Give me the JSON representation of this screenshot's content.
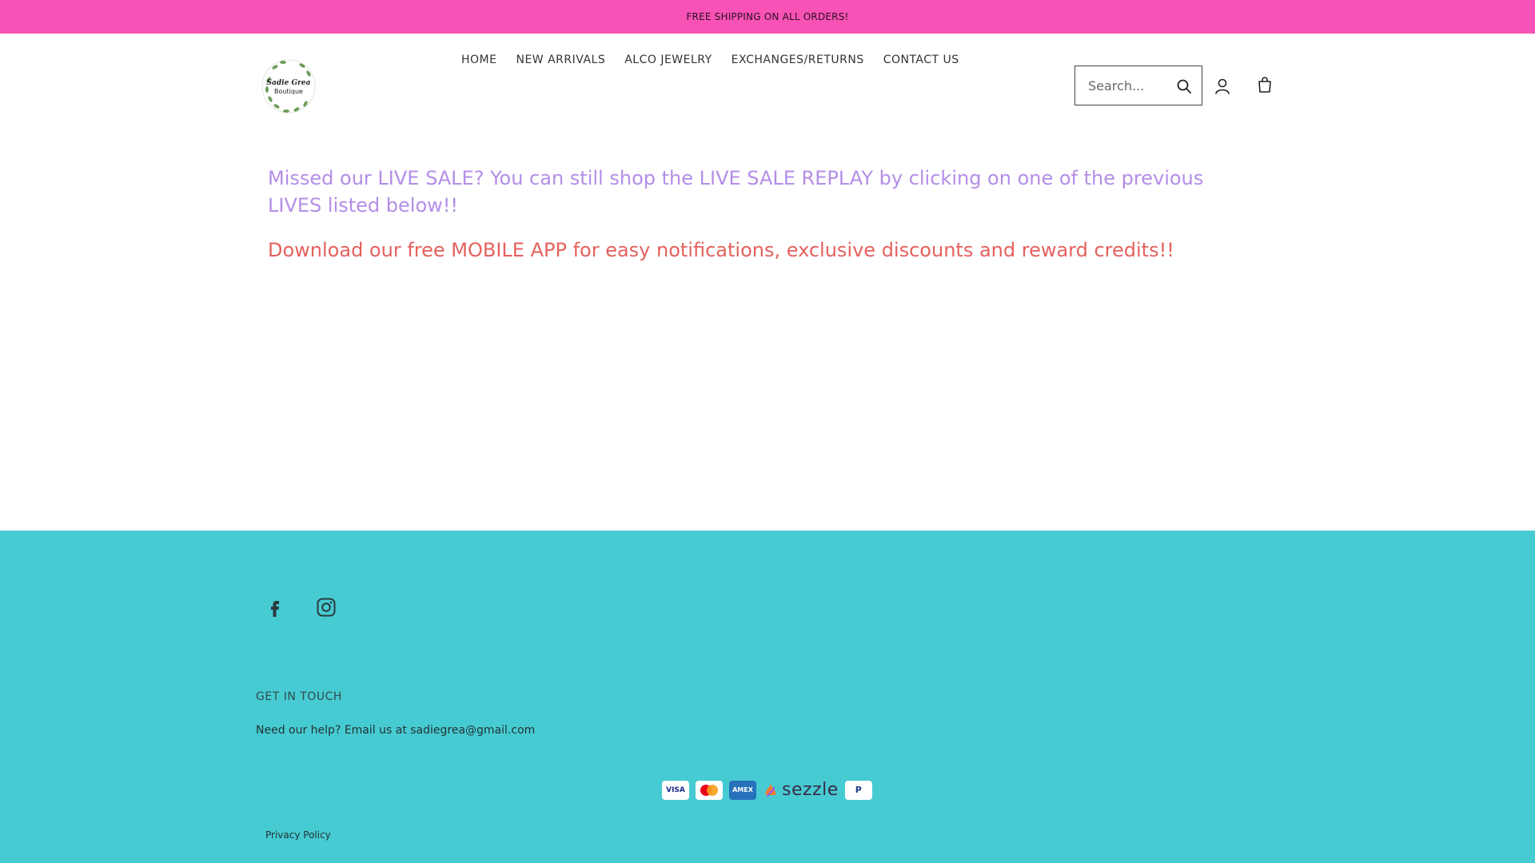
{
  "announcement": "FREE SHIPPING ON ALL ORDERS!",
  "logo": {
    "line1": "Sadie Grea",
    "line2": "Boutique"
  },
  "nav": [
    {
      "label": "HOME"
    },
    {
      "label": "NEW ARRIVALS"
    },
    {
      "label": "ALCO JEWELRY"
    },
    {
      "label": "EXCHANGES/RETURNS"
    },
    {
      "label": "CONTACT US"
    }
  ],
  "search": {
    "placeholder": "Search..."
  },
  "main": {
    "promo1": "Missed our LIVE SALE?  You can still shop the LIVE SALE REPLAY by clicking on one of the previous LIVES listed below!!",
    "promo2": "Download our free MOBILE APP for easy notifications, exclusive discounts and reward credits!!"
  },
  "footer": {
    "social": [
      "facebook-icon",
      "instagram-icon"
    ],
    "get_in_touch": "GET IN TOUCH",
    "help_text": "Need our help? Email us at sadiegrea@gmail.com",
    "payments": {
      "visa": "VISA",
      "amex": "AMEX",
      "sezzle": "sezzle",
      "paypal": "P"
    },
    "privacy": "Privacy Policy"
  },
  "colors": {
    "announcement_bg": "#f852b6",
    "promo1": "#b48ee8",
    "promo2": "#e4615e",
    "footer_bg": "#47cbd3"
  }
}
